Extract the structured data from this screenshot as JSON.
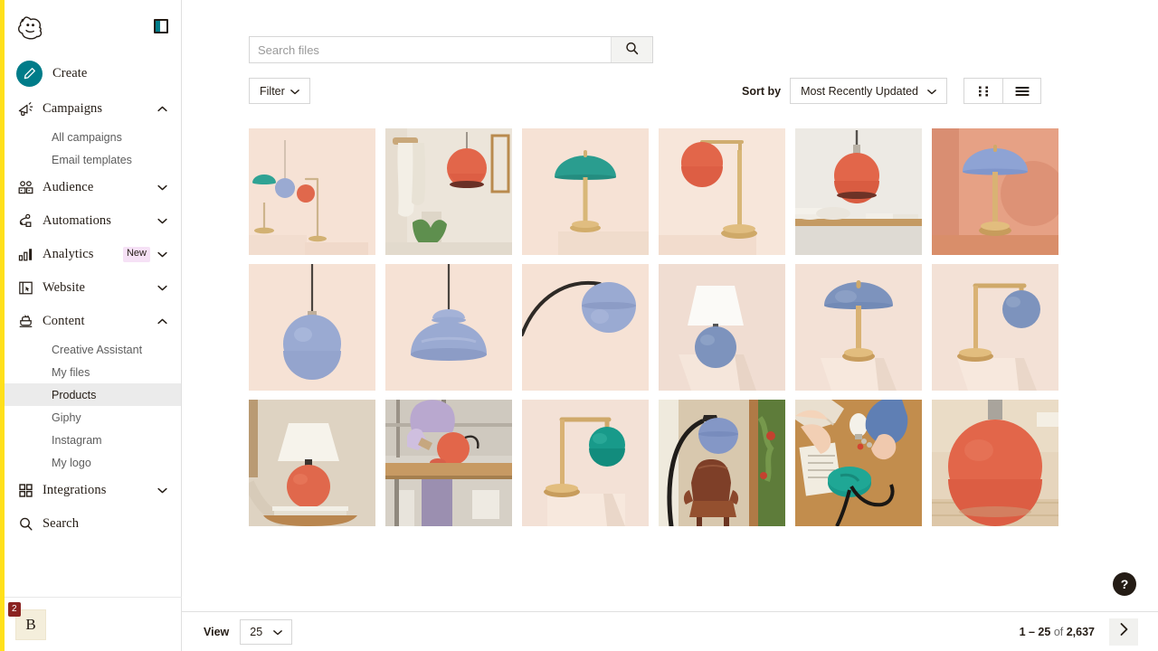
{
  "brand": {
    "logo_icon": "mailchimp-freddie-logo",
    "panel_toggle_icon": "panel-collapse-icon",
    "accent_yellow": "#ffe01b",
    "accent_teal": "#007c89"
  },
  "sidebar": {
    "create": {
      "label": "Create",
      "icon": "pencil-icon"
    },
    "items": [
      {
        "label": "Campaigns",
        "icon": "megaphone-icon",
        "expanded": true,
        "chevron": "chevron-up-icon"
      },
      {
        "label": "Audience",
        "icon": "audience-icon",
        "expanded": false,
        "chevron": "chevron-down-icon"
      },
      {
        "label": "Automations",
        "icon": "automations-icon",
        "expanded": false,
        "chevron": "chevron-down-icon"
      },
      {
        "label": "Analytics",
        "icon": "bar-chart-icon",
        "expanded": false,
        "chevron": "chevron-down-icon",
        "badge": "New"
      },
      {
        "label": "Website",
        "icon": "website-icon",
        "expanded": false,
        "chevron": "chevron-down-icon"
      },
      {
        "label": "Content",
        "icon": "content-icon",
        "expanded": true,
        "chevron": "chevron-up-icon"
      },
      {
        "label": "Integrations",
        "icon": "grid-squares-icon",
        "expanded": false,
        "chevron": "chevron-down-icon"
      },
      {
        "label": "Search",
        "icon": "search-icon",
        "expanded": false
      }
    ],
    "campaigns_sub": [
      {
        "label": "All campaigns",
        "active": false
      },
      {
        "label": "Email templates",
        "active": false
      }
    ],
    "content_sub": [
      {
        "label": "Creative Assistant",
        "active": false
      },
      {
        "label": "My files",
        "active": false
      },
      {
        "label": "Products",
        "active": true
      },
      {
        "label": "Giphy",
        "active": false
      },
      {
        "label": "Instagram",
        "active": false
      },
      {
        "label": "My logo",
        "active": false
      }
    ],
    "account": {
      "avatar_initial": "B",
      "notification_count": "2"
    }
  },
  "toolbar": {
    "search_placeholder": "Search files",
    "search_value": "",
    "search_icon": "search-icon",
    "filter_label": "Filter",
    "filter_chevron": "chevron-down-icon",
    "sort_by_label": "Sort by",
    "sort_value": "Most Recently Updated",
    "sort_chevron": "chevron-down-icon",
    "grid_view_icon": "grid-view-icon",
    "list_view_icon": "list-view-icon",
    "active_view": "grid"
  },
  "gallery": {
    "tiles": [
      {
        "name": "three-lamps-grouping",
        "alt": "Teal dome table lamp, blue globe pendant and coral globe desk lamp on plinths",
        "bg": "#f6e2d5",
        "kind": "trio"
      },
      {
        "name": "coral-pendant-bathroom",
        "alt": "Coral globe pendant lamp in bathroom with hanging towels and plant",
        "bg": "#e8e2d8",
        "kind": "bathroom"
      },
      {
        "name": "teal-dome-table-lamp",
        "alt": "Teal dome table lamp with brass stem on plinth",
        "bg": "#f6e2d5",
        "kind": "dome-table",
        "shade": "#2a9d8f"
      },
      {
        "name": "coral-globe-desk-lamp",
        "alt": "Coral globe desk lamp with brass arm",
        "bg": "#f7e6da",
        "kind": "arm-desk",
        "shade": "#e2664a"
      },
      {
        "name": "coral-pendant-kitchen",
        "alt": "Coral globe pendant over kitchen shelf with bowls and plates",
        "bg": "#e9e6e0",
        "kind": "kitchen"
      },
      {
        "name": "blue-dome-lamp-peach-room",
        "alt": "Blue dome table lamp in peach interior scene",
        "bg": "#e8a88c",
        "kind": "dome-room",
        "shade": "#8ea3d4"
      },
      {
        "name": "blue-globe-pendant",
        "alt": "Blue globe pendant lamp on cord",
        "bg": "#f6e2d5",
        "kind": "globe-pendant",
        "shade": "#9aaad2"
      },
      {
        "name": "blue-wide-dome-pendant",
        "alt": "Wide blue dome pendant lamp on cord",
        "bg": "#f6e2d5",
        "kind": "wide-pendant",
        "shade": "#9aaad2"
      },
      {
        "name": "blue-arc-floor-lamp-detail",
        "alt": "Blue dome shade on curved arc floor lamp",
        "bg": "#f6e2d5",
        "kind": "arc-detail",
        "shade": "#9aaad2"
      },
      {
        "name": "blue-sphere-lamp-white-shade",
        "alt": "Blue sphere base lamp with white drum shade on plinth",
        "bg": "#f0ddd2",
        "kind": "sphere-white",
        "shade": "#7d93bd"
      },
      {
        "name": "blue-dome-table-lamp",
        "alt": "Blue dome table lamp with brass stem on plinth",
        "bg": "#f3e1d6",
        "kind": "dome-table",
        "shade": "#7d93bd"
      },
      {
        "name": "blue-globe-desk-lamp",
        "alt": "Blue globe desk lamp with brass arm on plinth",
        "bg": "#f3e1d6",
        "kind": "arm-desk",
        "shade": "#7d93bd"
      },
      {
        "name": "coral-sphere-lamp-nightstand",
        "alt": "Coral sphere lamp with white shade on books on a side table",
        "bg": "#ded3c2",
        "kind": "nightstand"
      },
      {
        "name": "maker-assembling-coral-lamp",
        "alt": "Person in lilac shirt assembling a coral globe lamp at a workbench",
        "bg": "#c9ab8e",
        "kind": "workshop"
      },
      {
        "name": "teal-globe-desk-lamp",
        "alt": "Teal globe desk lamp with brass arm on plinth",
        "bg": "#f3e1d6",
        "kind": "arm-desk",
        "shade": "#189a8a"
      },
      {
        "name": "blue-arc-lamp-leather-chair",
        "alt": "Blue arc floor lamp over brown leather chair beside window",
        "bg": "#d9c9b0",
        "kind": "chair-room"
      },
      {
        "name": "hands-wiring-teal-lamp-base",
        "alt": "Hands wiring a teal lamp base on a wooden table with bulb and parts",
        "bg": "#c08a4a",
        "kind": "wiring"
      },
      {
        "name": "coral-sphere-lamp-closeup",
        "alt": "Close up of coral sphere lamp base on wooden floor",
        "bg": "#e4d3bd",
        "kind": "closeup"
      }
    ]
  },
  "help": {
    "icon": "question-mark-icon",
    "label": "?"
  },
  "footer": {
    "view_label": "View",
    "view_value": "25",
    "view_chevron": "chevron-down-icon",
    "range_start": "1 – 25",
    "range_middle": " of ",
    "range_total": "2,637",
    "next_icon": "chevron-right-icon"
  }
}
